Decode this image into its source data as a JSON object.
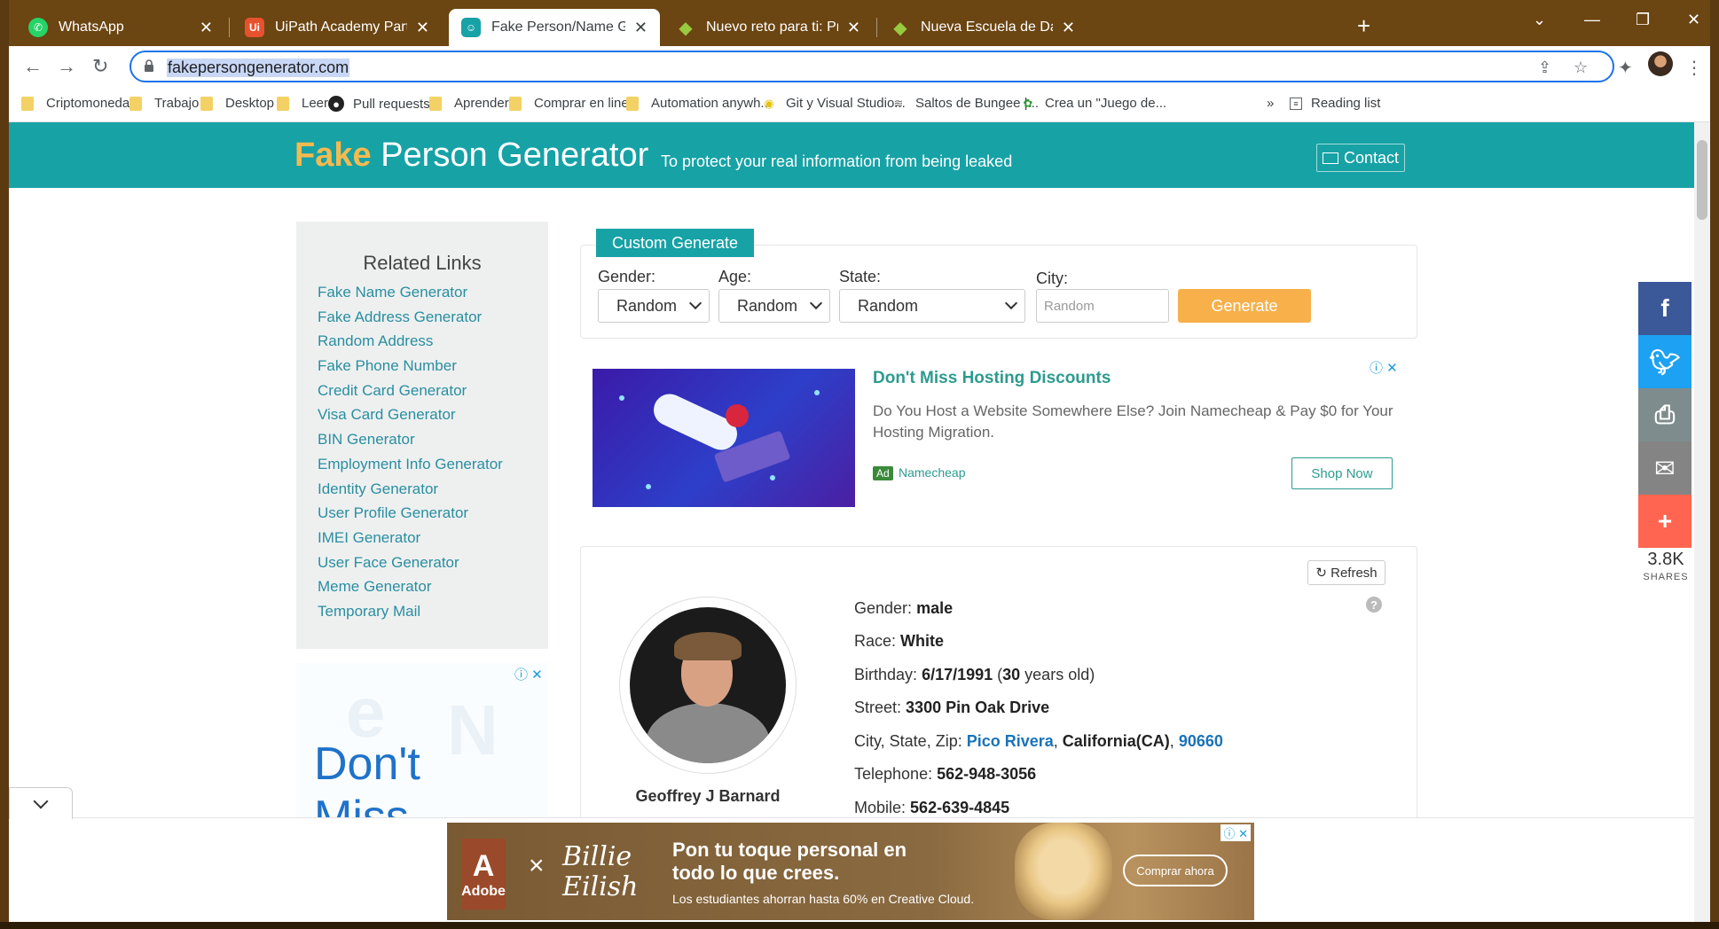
{
  "browser": {
    "tabs": [
      {
        "title": "WhatsApp",
        "icon": "whatsapp-icon",
        "color": "#25d366"
      },
      {
        "title": "UiPath Academy Partners",
        "icon": "uipath-icon",
        "color": "#e8512e"
      },
      {
        "title": "Fake Person/Name Generator | U",
        "icon": "person-icon",
        "color": "#17a2a6",
        "active": true
      },
      {
        "title": "Nuevo reto para ti: Propósitos de",
        "icon": "platzi-icon",
        "color": "#98ca3f"
      },
      {
        "title": "Nueva Escuela de Data Science e",
        "icon": "platzi-icon",
        "color": "#98ca3f"
      }
    ],
    "url": "fakepersongenerator.com",
    "bookmarks": [
      {
        "label": "Criptomonedas",
        "type": "folder"
      },
      {
        "label": "Trabajo",
        "type": "folder"
      },
      {
        "label": "Desktop",
        "type": "folder"
      },
      {
        "label": "Leer",
        "type": "folder"
      },
      {
        "label": "Pull requests",
        "type": "github"
      },
      {
        "label": "Aprender",
        "type": "folder"
      },
      {
        "label": "Comprar en linea",
        "type": "folder"
      },
      {
        "label": "Automation anywh...",
        "type": "folder"
      },
      {
        "label": "Git y Visual Studio...",
        "type": "site"
      },
      {
        "label": "Saltos de Bungee |...",
        "type": "site"
      },
      {
        "label": "Crea un \"Juego de...",
        "type": "site"
      }
    ],
    "overflow": "»",
    "reading_list": "Reading list"
  },
  "header": {
    "logo_fake": "Fake",
    "logo_rest": "Person Generator",
    "tagline": "To protect your real information from being leaked",
    "contact": "Contact"
  },
  "sidebar": {
    "title": "Related Links",
    "links": [
      "Fake Name Generator",
      "Fake Address Generator",
      "Random Address",
      "Fake Phone Number",
      "Credit Card Generator",
      "Visa Card Generator",
      "BIN Generator",
      "Employment Info Generator",
      "Identity Generator",
      "User Profile Generator",
      "IMEI Generator",
      "User Face Generator",
      "Meme Generator",
      "Temporary Mail"
    ],
    "ad_line1": "Don't",
    "ad_line2": "Miss"
  },
  "generator": {
    "label": "Custom Generate",
    "gender_label": "Gender:",
    "gender_value": "Random",
    "age_label": "Age:",
    "age_value": "Random",
    "state_label": "State:",
    "state_value": "Random",
    "city_label": "City:",
    "city_placeholder": "Random",
    "generate": "Generate"
  },
  "ad": {
    "title": "Don't Miss Hosting Discounts",
    "description": "Do You Host a Website Somewhere Else? Join Namecheap & Pay $0 for Your Hosting Migration.",
    "badge": "Ad",
    "source": "Namecheap",
    "cta": "Shop Now"
  },
  "person": {
    "refresh": "Refresh",
    "name": "Geoffrey J Barnard",
    "gender_label": "Gender:",
    "gender": "male",
    "race_label": "Race:",
    "race": "White",
    "birthday_label": "Birthday:",
    "birthday": "6/17/1991",
    "age_open": " (",
    "age": "30",
    "age_suffix": " years old)",
    "street_label": "Street:",
    "street": "3300 Pin Oak Drive",
    "csz_label": "City, State, Zip:",
    "city": "Pico Rivera",
    "state": "California(CA)",
    "zip": "90660",
    "telephone_label": "Telephone:",
    "telephone": "562-948-3056",
    "mobile_label": "Mobile:",
    "mobile": "562-639-4845"
  },
  "share": {
    "count": "3.8K",
    "label": "SHARES",
    "buttons": [
      {
        "name": "facebook",
        "glyph": "f",
        "color": "#3b5998"
      },
      {
        "name": "twitter",
        "glyph": "t",
        "color": "#1da1f2"
      },
      {
        "name": "print",
        "glyph": "⎙",
        "color": "#7f8c8d"
      },
      {
        "name": "email",
        "glyph": "✉",
        "color": "#848484"
      },
      {
        "name": "more",
        "glyph": "+",
        "color": "#ff6550"
      }
    ]
  },
  "banner": {
    "brand": "Adobe",
    "times": "×",
    "artist_line1": "Billie",
    "artist_line2": "Eilish",
    "headline_line1": "Pon tu toque personal en",
    "headline_line2": "todo lo que crees.",
    "subtext": "Los estudiantes ahorran hasta 60% en Creative Cloud.",
    "cta": "Comprar ahora"
  }
}
